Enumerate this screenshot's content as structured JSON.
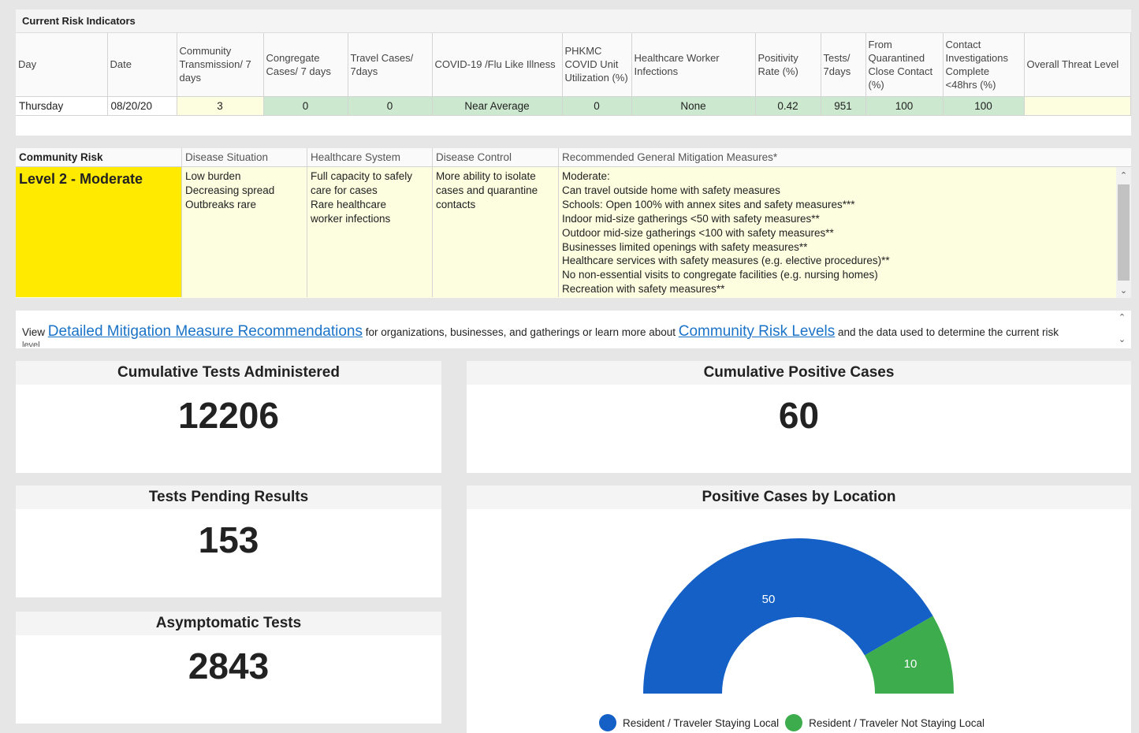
{
  "indicators": {
    "title": "Current Risk Indicators",
    "headers": [
      "Day",
      "Date",
      "Community Transmission/ 7 days",
      "Congregate Cases/ 7 days",
      "Travel Cases/ 7days",
      "COVID-19 /Flu Like Illness",
      "PHKMC COVID Unit Utilization (%)",
      "Healthcare Worker Infections",
      "Positivity Rate (%)",
      "Tests/ 7days",
      "From Quarantined Close Contact (%)",
      "Contact Investigations Complete <48hrs (%)",
      "Overall Threat Level"
    ],
    "row": [
      "Thursday",
      "08/20/20",
      "3",
      "0",
      "0",
      "Near Average",
      "0",
      "None",
      "0.42",
      "951",
      "100",
      "100",
      ""
    ]
  },
  "risk": {
    "headers": [
      "Community Risk",
      "Disease Situation",
      "Healthcare System",
      "Disease Control",
      "Recommended General Mitigation Measures*"
    ],
    "level": "Level 2 - Moderate",
    "situation": [
      "Low burden",
      "Decreasing spread",
      "Outbreaks rare"
    ],
    "healthcare": [
      "Full capacity to safely",
      "care for cases",
      "Rare healthcare",
      "worker infections"
    ],
    "control": [
      "More ability to isolate",
      "cases and quarantine",
      "contacts"
    ],
    "measures": [
      "Moderate:",
      "Can travel outside home with safety measures",
      "Schools: Open 100% with annex sites and safety measures***",
      "Indoor mid-size gatherings <50 with safety measures**",
      "Outdoor mid-size gatherings <100 with safety measures**",
      "Businesses limited openings with safety measures**",
      "Healthcare services with safety measures (e.g. elective procedures)**",
      "No non-essential visits to congregate facilities (e.g. nursing homes)",
      "Recreation with safety measures**"
    ],
    "scroll_up": "⌃",
    "scroll_down": "⌄"
  },
  "links": {
    "prefix": "View",
    "link1": "Detailed Mitigation Measure Recommendations",
    "middle": "for organizations, businesses, and gatherings or learn more about",
    "link2": "Community Risk Levels",
    "suffix": "and the data used to determine the current risk",
    "clipped": "level"
  },
  "cards": {
    "tests_title": "Cumulative Tests Administered",
    "tests_value": "12206",
    "positive_title": "Cumulative Positive Cases",
    "positive_value": "60",
    "pending_title": "Tests Pending Results",
    "pending_value": "153",
    "asym_title": "Asymptomatic Tests",
    "asym_value": "2843",
    "location_title": "Positive Cases by Location"
  },
  "colors": {
    "series1": "#1560c6",
    "series2": "#3cac4c",
    "risk_yellow": "#ffea00"
  },
  "chart_data": {
    "type": "pie",
    "title": "Positive Cases by Location",
    "series": [
      {
        "name": "Resident / Traveler Staying Local",
        "value": 50
      },
      {
        "name": "Resident / Traveler Not Staying Local",
        "value": 10
      }
    ],
    "style": "half-donut",
    "legend": "bottom"
  }
}
